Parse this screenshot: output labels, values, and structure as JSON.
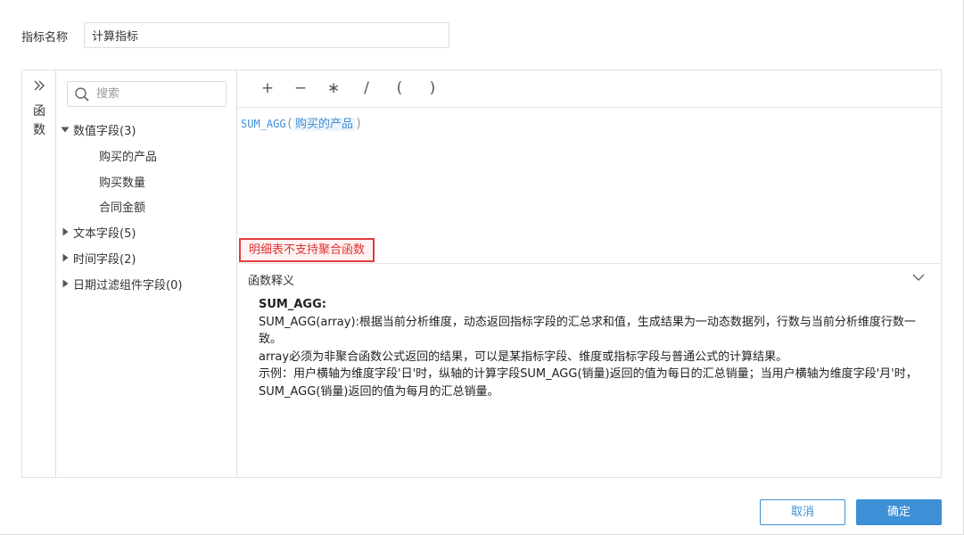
{
  "indicator_name": {
    "label": "指标名称",
    "value": "计算指标"
  },
  "function_strip": {
    "label_line1": "函",
    "label_line2": "数",
    "icon": "double-chevron-right-icon"
  },
  "search": {
    "placeholder": "搜索",
    "icon": "search-icon"
  },
  "tree": {
    "numeric_group": {
      "label": "数值字段(3)",
      "expanded": true,
      "items": [
        "购买的产品",
        "购买数量",
        "合同金额"
      ]
    },
    "text_group": {
      "label": "文本字段(5)",
      "expanded": false
    },
    "time_group": {
      "label": "时间字段(2)",
      "expanded": false
    },
    "date_filter_group": {
      "label": "日期过滤组件字段(0)",
      "expanded": false
    }
  },
  "operators": [
    "+",
    "−",
    "∗",
    "/",
    "(",
    ")"
  ],
  "formula": {
    "function": "SUM_AGG",
    "open_paren": "(",
    "field": "购买的产品",
    "close_paren": ")"
  },
  "error_tip": "明细表不支持聚合函数",
  "description": {
    "header": "函数释义",
    "title": "SUM_AGG:",
    "line1": "SUM_AGG(array):根据当前分析维度，动态返回指标字段的汇总求和值，生成结果为一动态数据列，行数与当前分析维度行数一致。",
    "line2": " array必须为非聚合函数公式返回的结果，可以是某指标字段、维度或指标字段与普通公式的计算结果。",
    "line3": " 示例：用户横轴为维度字段'日'时，纵轴的计算字段SUM_AGG(销量)返回的值为每日的汇总销量；当用户横轴为维度字段'月'时，SUM_AGG(销量)返回的值为每月的汇总销量。"
  },
  "buttons": {
    "cancel": "取消",
    "ok": "确定"
  },
  "colors": {
    "accent": "#3d8fd6",
    "error": "#e23c3c"
  }
}
